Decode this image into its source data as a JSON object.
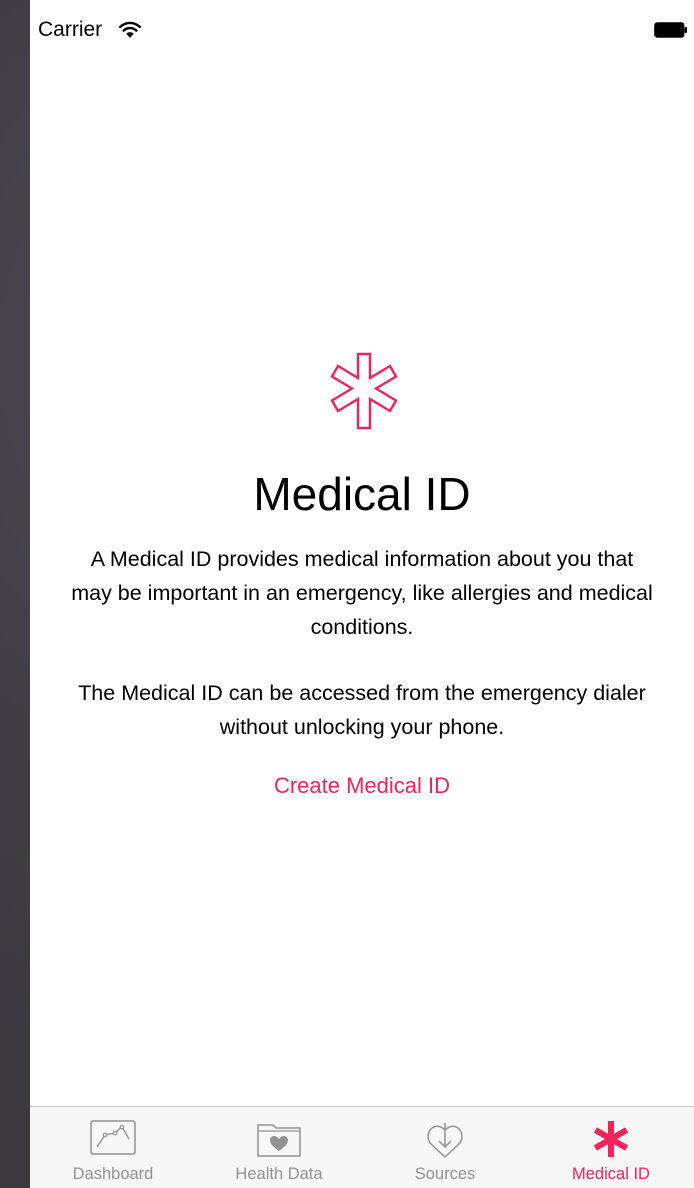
{
  "status_bar": {
    "carrier": "Carrier"
  },
  "main": {
    "title": "Medical ID",
    "description_1": "A Medical ID provides medical information about you that may be important in an emergency, like allergies and medical conditions.",
    "description_2": "The Medical ID can be accessed from the emergency dialer without unlocking your phone.",
    "create_label": "Create Medical ID"
  },
  "tabs": [
    {
      "label": "Dashboard",
      "icon": "dashboard-icon",
      "active": false
    },
    {
      "label": "Health Data",
      "icon": "health-data-icon",
      "active": false
    },
    {
      "label": "Sources",
      "icon": "sources-icon",
      "active": false
    },
    {
      "label": "Medical ID",
      "icon": "medical-id-icon",
      "active": true
    }
  ],
  "colors": {
    "accent": "#f0245a",
    "tab_inactive": "#929292",
    "tab_bar_bg": "#f7f7f7"
  }
}
